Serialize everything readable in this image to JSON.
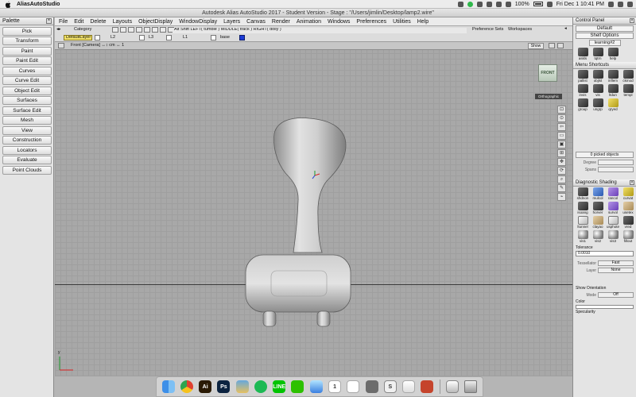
{
  "mac_menubar": {
    "app_name": "AliasAutoStudio",
    "battery": "100%",
    "datetime": "Fri Dec 1  10:41 PM"
  },
  "app_titlebar": {
    "title": "Autodesk Alias AutoStudio 2017  - Student Version  - Stage : \"/Users/jimlin/Desktop/lamp2.wire\""
  },
  "palette": {
    "title": "Palette",
    "items": [
      "Pick",
      "Transform",
      "Paint",
      "Paint Edit",
      "Curves",
      "Curve Edit",
      "Object Edit",
      "Surfaces",
      "Surface Edit",
      "Mesh",
      "View",
      "Construction",
      "Locators",
      "Evaluate",
      "Point Clouds"
    ]
  },
  "app_menu": {
    "items": [
      "File",
      "Edit",
      "Delete",
      "Layouts",
      "ObjectDisplay",
      "WindowDisplay",
      "Layers",
      "Canvas",
      "Render",
      "Animation",
      "Windows",
      "Preferences",
      "Utilities",
      "Help"
    ]
  },
  "layer_bar": {
    "category_label": "Category",
    "default_layer": "DefaultLayer",
    "l2": "L2",
    "l3": "L3",
    "l1": "L1",
    "base": "base",
    "mouse_hint": "Alt Shift   LEFT( tumble )   MIDDLE( track )   RIGHT( dolly )",
    "preference_sets": "Preference Sets",
    "workspaces": "Workspaces"
  },
  "viewport": {
    "camera_label": "Front [Camera]   ↔↕ cm   ↔ 1",
    "show_button": "Show",
    "view_cube": "FRONT",
    "ortho_label": "Orthographic",
    "axis_label": "y"
  },
  "control_panel": {
    "title": "Control Panel",
    "default_select": "Default",
    "shelf_options": "Shelf Options",
    "shelf_tab": "learning#2",
    "top_icons": [
      {
        "label": "askls",
        "style": "g-gray"
      },
      {
        "label": "tqtrn",
        "style": "g-gray"
      },
      {
        "label": "help",
        "style": "g-gray"
      }
    ],
    "menu_shortcuts": "Menu Shortcuts",
    "shortcut_icons": [
      {
        "label": "pallist",
        "style": "g-gray"
      },
      {
        "label": "objlst",
        "style": "g-gray"
      },
      {
        "label": "inflem",
        "style": "g-gray"
      },
      {
        "label": "ckmod",
        "style": "g-gray"
      },
      {
        "label": "invis",
        "style": "g-gray"
      },
      {
        "label": "vis",
        "style": "g-gray"
      },
      {
        "label": "ltdun",
        "style": "g-gray"
      },
      {
        "label": "templ",
        "style": "g-gray"
      },
      {
        "label": "group",
        "style": "g-gray"
      },
      {
        "label": "ungrp",
        "style": "g-gray"
      },
      {
        "label": "qryed",
        "style": "g-yellow"
      }
    ],
    "picked_objects": "0 picked objects",
    "degree_label": "Degree",
    "spans_label": "Spans",
    "diagnostic_title": "Diagnostic Shading",
    "diagnostic_icons": [
      {
        "label": "shdnon",
        "style": "g-gray"
      },
      {
        "label": "mulcol",
        "style": "g-blue"
      },
      {
        "label": "rancol",
        "style": "g-purple"
      },
      {
        "label": "curvat",
        "style": "g-yellow"
      },
      {
        "label": "isoang",
        "style": "g-gray"
      },
      {
        "label": "horver",
        "style": "g-gray"
      },
      {
        "label": "survol",
        "style": "g-purple"
      },
      {
        "label": "usetex",
        "style": "g-tan"
      },
      {
        "label": "ltunnel",
        "style": "g-white"
      },
      {
        "label": "clayao",
        "style": "g-tan"
      },
      {
        "label": "usphote",
        "style": "g-white"
      },
      {
        "label": "vred",
        "style": "g-gray"
      },
      {
        "label": "vis1",
        "style": "g-sphere"
      },
      {
        "label": "vis2",
        "style": "g-sphere"
      },
      {
        "label": "vis3",
        "style": "g-sphere"
      },
      {
        "label": "fillout",
        "style": "g-sphere"
      }
    ],
    "tolerance_label": "Tolerance",
    "tolerance_value": "0.0010",
    "tessellator_label": "Tessellator",
    "tessellator_value": "Fast",
    "layer_label": "Layer",
    "layer_value": "None",
    "show_orientation": "Show Orientation",
    "mode_label": "Mode",
    "mode_value": "Off",
    "color_label": "Color",
    "specularity_label": "Specularity"
  },
  "dock": {
    "items": [
      {
        "name": "finder-icon",
        "style": "d-finder",
        "glyph": ""
      },
      {
        "name": "chrome-icon",
        "style": "d-chrome",
        "glyph": ""
      },
      {
        "name": "illustrator-icon",
        "style": "d-ai",
        "glyph": "Ai"
      },
      {
        "name": "photoshop-icon",
        "style": "d-ps",
        "glyph": "Ps"
      },
      {
        "name": "preview-icon",
        "style": "d-img",
        "glyph": ""
      },
      {
        "name": "spotify-icon",
        "style": "d-spot",
        "glyph": ""
      },
      {
        "name": "line-icon",
        "style": "d-line",
        "glyph": "LINE"
      },
      {
        "name": "wechat-icon",
        "style": "d-we",
        "glyph": ""
      },
      {
        "name": "messages-icon",
        "style": "d-msg",
        "glyph": ""
      },
      {
        "name": "calendar-icon",
        "style": "d-cal",
        "glyph": "1"
      },
      {
        "name": "acrobat-icon",
        "style": "d-pdf",
        "glyph": ""
      },
      {
        "name": "app-icon",
        "style": "d-mid",
        "glyph": ""
      },
      {
        "name": "sublime-icon",
        "style": "d-sub",
        "glyph": "S"
      },
      {
        "name": "music-icon",
        "style": "d-music",
        "glyph": ""
      },
      {
        "name": "alias-icon",
        "style": "d-alias",
        "glyph": ""
      },
      {
        "name": "separator",
        "style": "d-sep",
        "glyph": ""
      },
      {
        "name": "folder-icon",
        "style": "d-folder",
        "glyph": ""
      },
      {
        "name": "trash-icon",
        "style": "d-trash",
        "glyph": ""
      }
    ]
  }
}
